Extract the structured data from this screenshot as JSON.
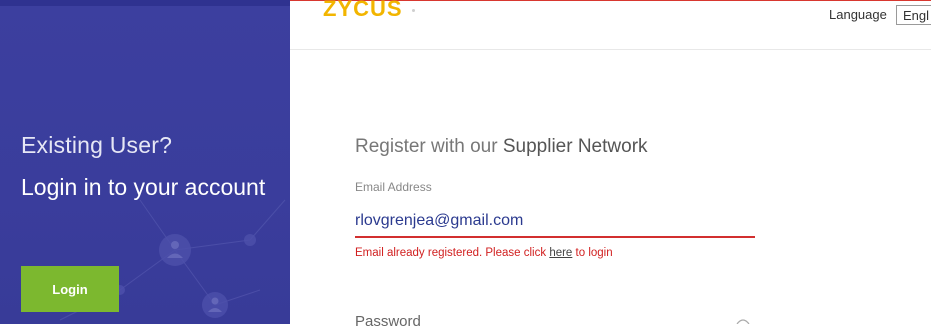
{
  "left_panel": {
    "existing_user": "Existing User?",
    "login_prompt": "Login in to your account",
    "login_button": "Login"
  },
  "header": {
    "logo": "ZYCUS",
    "language_label": "Language",
    "language_value": "Engl"
  },
  "form": {
    "heading_prefix": "Register with our",
    "heading_strong": "Supplier Network",
    "email_label": "Email Address",
    "email_value": "rlovgrenjea@gmail.com",
    "error_prefix": "Email already registered. Please click",
    "error_link": "here",
    "error_suffix": "to login",
    "password_label": "Password"
  },
  "colors": {
    "panel": "#3c3f9f",
    "login_button": "#7cb82f",
    "error": "#d11f1f",
    "logo": "#f2b500"
  }
}
